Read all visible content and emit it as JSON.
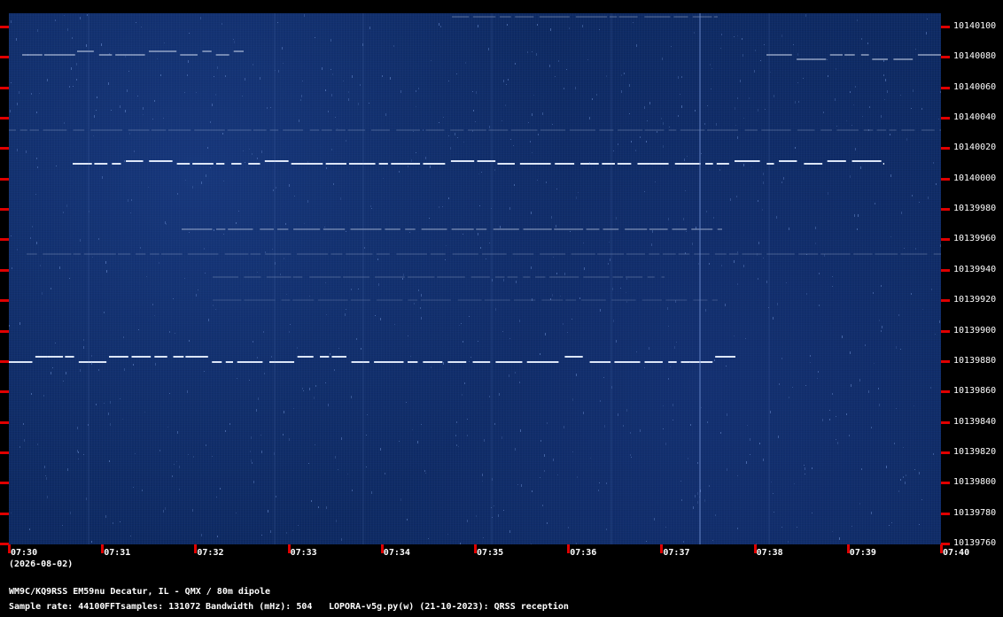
{
  "y_axis": {
    "labels": [
      "10140100",
      "10140080",
      "10140060",
      "10140040",
      "10140020",
      "10140000",
      "10139980",
      "10139960",
      "10139940",
      "10139920",
      "10139900",
      "10139880",
      "10139860",
      "10139840",
      "10139820",
      "10139800",
      "10139780",
      "10139760"
    ]
  },
  "x_axis": {
    "labels": [
      "07:30",
      "07:31",
      "07:32",
      "07:33",
      "07:34",
      "07:35",
      "07:36",
      "07:37",
      "07:38",
      "07:39",
      "07:40"
    ],
    "date": "(2026-08-02)"
  },
  "footer": {
    "station": "WM9C/KQ9RSS EM59nu Decatur, IL - QMX / 80m dipole",
    "sample_rate": "Sample rate: 44100",
    "fft_samples": "FFTsamples: 131072",
    "bandwidth": "Bandwidth (mHz): 504",
    "software": "LOPORA-v5g.py(w) (21-10-2023): QRSS reception"
  },
  "colors": {
    "background": "#000000",
    "waterfall": "#0e2b66",
    "signal": "#e8f0ff",
    "tick": "#e00000"
  }
}
